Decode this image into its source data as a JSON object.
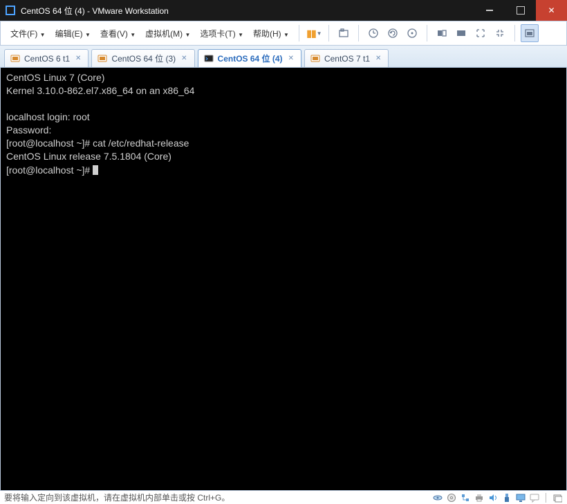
{
  "titlebar": {
    "text": "CentOS 64 位 (4) - VMware Workstation"
  },
  "menus": {
    "file": "文件(F)",
    "edit": "编辑(E)",
    "view": "查看(V)",
    "vm": "虚拟机(M)",
    "tabs": "选项卡(T)",
    "help": "帮助(H)"
  },
  "tabs": [
    {
      "label": "CentOS 6 t1",
      "active": false,
      "icon": "std"
    },
    {
      "label": "CentOS 64 位 (3)",
      "active": false,
      "icon": "std"
    },
    {
      "label": "CentOS 64 位 (4)",
      "active": true,
      "icon": "console"
    },
    {
      "label": "CentOS 7 t1",
      "active": false,
      "icon": "std"
    }
  ],
  "terminal": {
    "l1": "CentOS Linux 7 (Core)",
    "l2": "Kernel 3.10.0-862.el7.x86_64 on an x86_64",
    "l3": "",
    "l4": "localhost login: root",
    "l5": "Password:",
    "l6": "[root@localhost ~]# cat /etc/redhat-release",
    "l7": "CentOS Linux release 7.5.1804 (Core)",
    "l8": "[root@localhost ~]# "
  },
  "status": {
    "text": "要将输入定向到该虚拟机，请在虚拟机内部单击或按 Ctrl+G。"
  }
}
